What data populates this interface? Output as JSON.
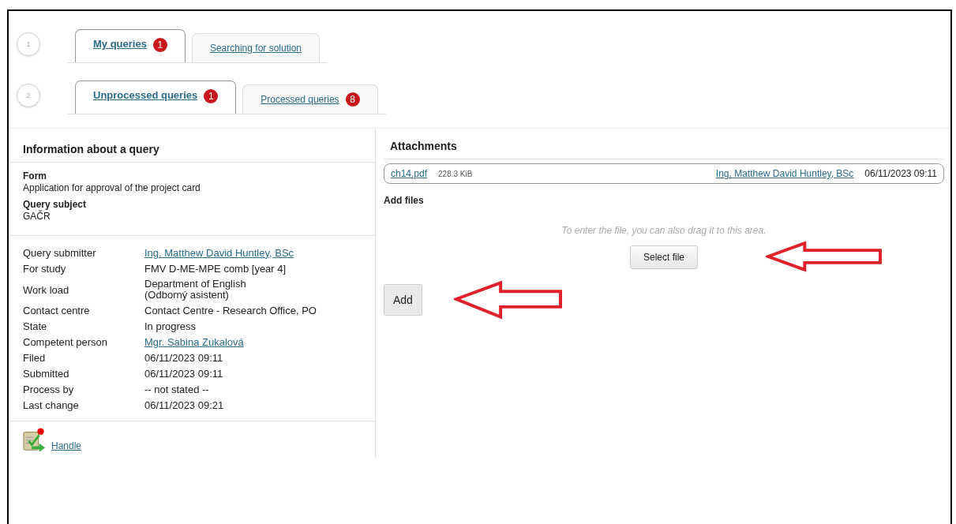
{
  "steps": [
    {
      "number": "1",
      "tabs": [
        {
          "label": "My queries",
          "badge": "1",
          "selected": true
        },
        {
          "label": "Searching for solution",
          "selected": false
        }
      ]
    },
    {
      "number": "2",
      "tabs": [
        {
          "label": "Unprocessed queries",
          "badge": "1",
          "selected": true
        },
        {
          "label": "Processed queries",
          "badge": "8",
          "selected": false
        }
      ]
    }
  ],
  "info": {
    "title": "Information about a query",
    "sections": [
      {
        "label": "Form",
        "value": "Application for approval of the project card"
      },
      {
        "label": "Query subject",
        "value": "GAČR"
      }
    ],
    "details": [
      {
        "label": "Query submitter",
        "value": "Ing. Matthew David Huntley, BSc",
        "kind": "link"
      },
      {
        "label": "For study",
        "value": "FMV D-ME-MPE comb [year 4]",
        "kind": "text"
      },
      {
        "label": "Work load",
        "value": "Department of English\n(Odborný asistent)",
        "kind": "text"
      },
      {
        "label": "Contact centre",
        "value": "Contact Centre - Research Office, PO",
        "kind": "text"
      },
      {
        "label": "State",
        "value": "In progress",
        "kind": "text"
      },
      {
        "label": "Competent person",
        "value": "Mgr. Sabina Zukalová",
        "kind": "link"
      },
      {
        "label": "Filed",
        "value": "06/11/2023 09:11",
        "kind": "text"
      },
      {
        "label": "Submitted",
        "value": "06/11/2023 09:11",
        "kind": "text"
      },
      {
        "label": "Process by",
        "value": "-- not stated --",
        "kind": "text"
      },
      {
        "label": "Last change",
        "value": "06/11/2023 09:21",
        "kind": "text"
      }
    ],
    "action": {
      "label": "Handle"
    }
  },
  "attachments": {
    "title": "Attachments",
    "files": [
      {
        "name": "ch14.pdf",
        "size": "228.3 KiB",
        "author": "Ing. Matthew David Huntley, BSc",
        "date": "06/11/2023 09:11"
      }
    ],
    "add_files": {
      "label": "Add files",
      "hint": "To enter the file, you can also drag it to this area.",
      "select_button": "Select file"
    },
    "add_button": "Add"
  }
}
